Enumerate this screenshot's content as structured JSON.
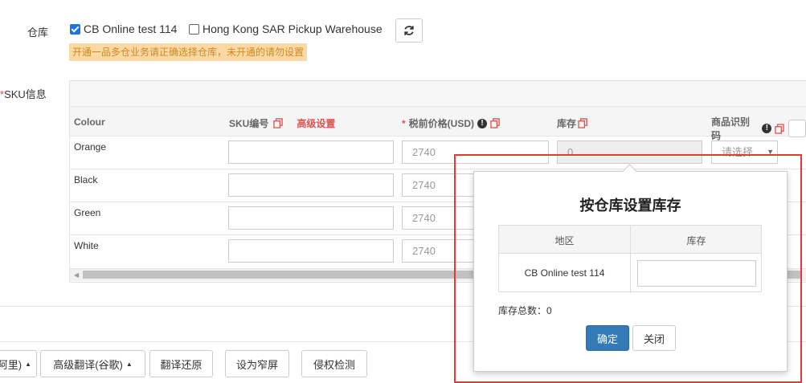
{
  "warehouse": {
    "label": "仓库",
    "options": [
      {
        "name": "CB Online test 114",
        "checked": true
      },
      {
        "name": "Hong Kong SAR Pickup Warehouse",
        "checked": false
      }
    ],
    "refresh_icon": "refresh-icon",
    "warning": "开通一品多仓业务请正确选择仓库，未开通的请勿设置"
  },
  "sku": {
    "label_star": "*",
    "label": "SKU信息",
    "columns": {
      "colour": "Colour",
      "sku_code": "SKU编号",
      "advanced": "高级设置",
      "price_star": "*",
      "price": "税前价格(USD)",
      "stock": "库存",
      "product_id": "商品识别码",
      "select_placeholder": "请选择"
    },
    "rows": [
      {
        "colour": "Orange",
        "price": "2740",
        "stock": "0"
      },
      {
        "colour": "Black",
        "price": "2740",
        "stock": ""
      },
      {
        "colour": "Green",
        "price": "2740",
        "stock": ""
      },
      {
        "colour": "White",
        "price": "2740",
        "stock": ""
      }
    ]
  },
  "popover": {
    "title": "按仓库设置库存",
    "col_region": "地区",
    "col_stock": "库存",
    "rows": [
      {
        "region": "CB Online test 114",
        "stock": ""
      }
    ],
    "total_label": "库存总数：",
    "total_value": "0",
    "confirm": "确定",
    "close": "关闭"
  },
  "toolbar": {
    "partial_label": "阿里)",
    "advanced_translate": "高级翻译(谷歌)",
    "restore": "翻译还原",
    "narrow": "设为窄屏",
    "infringe": "侵权检测"
  },
  "colors": {
    "accent": "#337ab7",
    "warning_bg": "#fcd9a3",
    "highlight_border": "#e53935",
    "link_red": "#d9534f"
  }
}
